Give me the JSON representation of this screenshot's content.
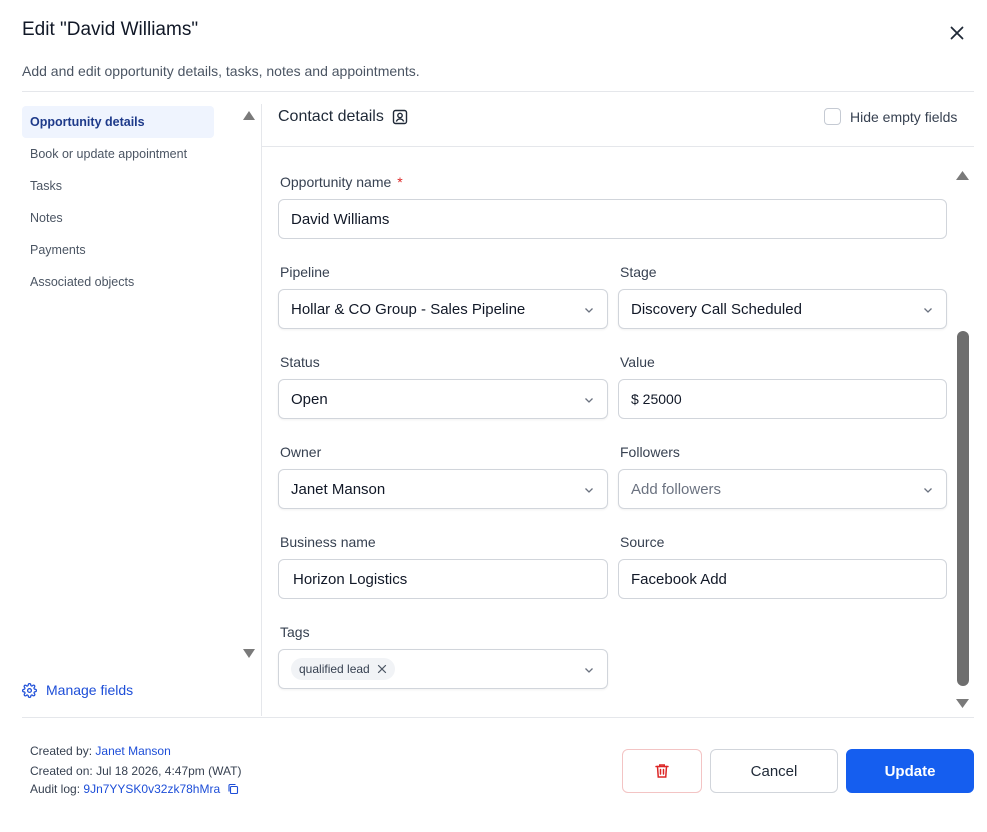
{
  "header": {
    "title": "Edit \"David Williams\"",
    "subtitle": "Add and edit opportunity details, tasks, notes and appointments."
  },
  "sidebar": {
    "items": [
      {
        "label": "Opportunity details",
        "active": true
      },
      {
        "label": "Book or update appointment"
      },
      {
        "label": "Tasks"
      },
      {
        "label": "Notes"
      },
      {
        "label": "Payments"
      },
      {
        "label": "Associated objects"
      }
    ],
    "manage_fields": "Manage fields"
  },
  "contact": {
    "heading": "Contact details",
    "hide_empty_label": "Hide empty fields"
  },
  "form": {
    "opportunity_name": {
      "label": "Opportunity name",
      "required_mark": "*",
      "value": "David Williams"
    },
    "pipeline": {
      "label": "Pipeline",
      "value": "Hollar & CO Group - Sales Pipeline"
    },
    "stage": {
      "label": "Stage",
      "value": "Discovery Call Scheduled"
    },
    "status": {
      "label": "Status",
      "value": "Open"
    },
    "value": {
      "label": "Value",
      "value": "$ 25000"
    },
    "owner": {
      "label": "Owner",
      "value": "Janet Manson"
    },
    "followers": {
      "label": "Followers",
      "placeholder": "Add followers"
    },
    "business_name": {
      "label": "Business name",
      "value": "Horizon Logistics"
    },
    "source": {
      "label": "Source",
      "value": "Facebook Add"
    },
    "tags": {
      "label": "Tags",
      "items": [
        "qualified lead"
      ]
    }
  },
  "footer": {
    "created_by_label": "Created by:",
    "created_by": "Janet Manson",
    "created_on_label": "Created on:",
    "created_on": "Jul 18 2026, 4:47pm (WAT)",
    "audit_log_label": "Audit log:",
    "audit_log": "9Jn7YYSK0v32zk78hMra",
    "cancel_label": "Cancel",
    "update_label": "Update"
  },
  "colors": {
    "primary": "#155eef",
    "danger": "#dc2626",
    "link": "#1d4ed8"
  }
}
